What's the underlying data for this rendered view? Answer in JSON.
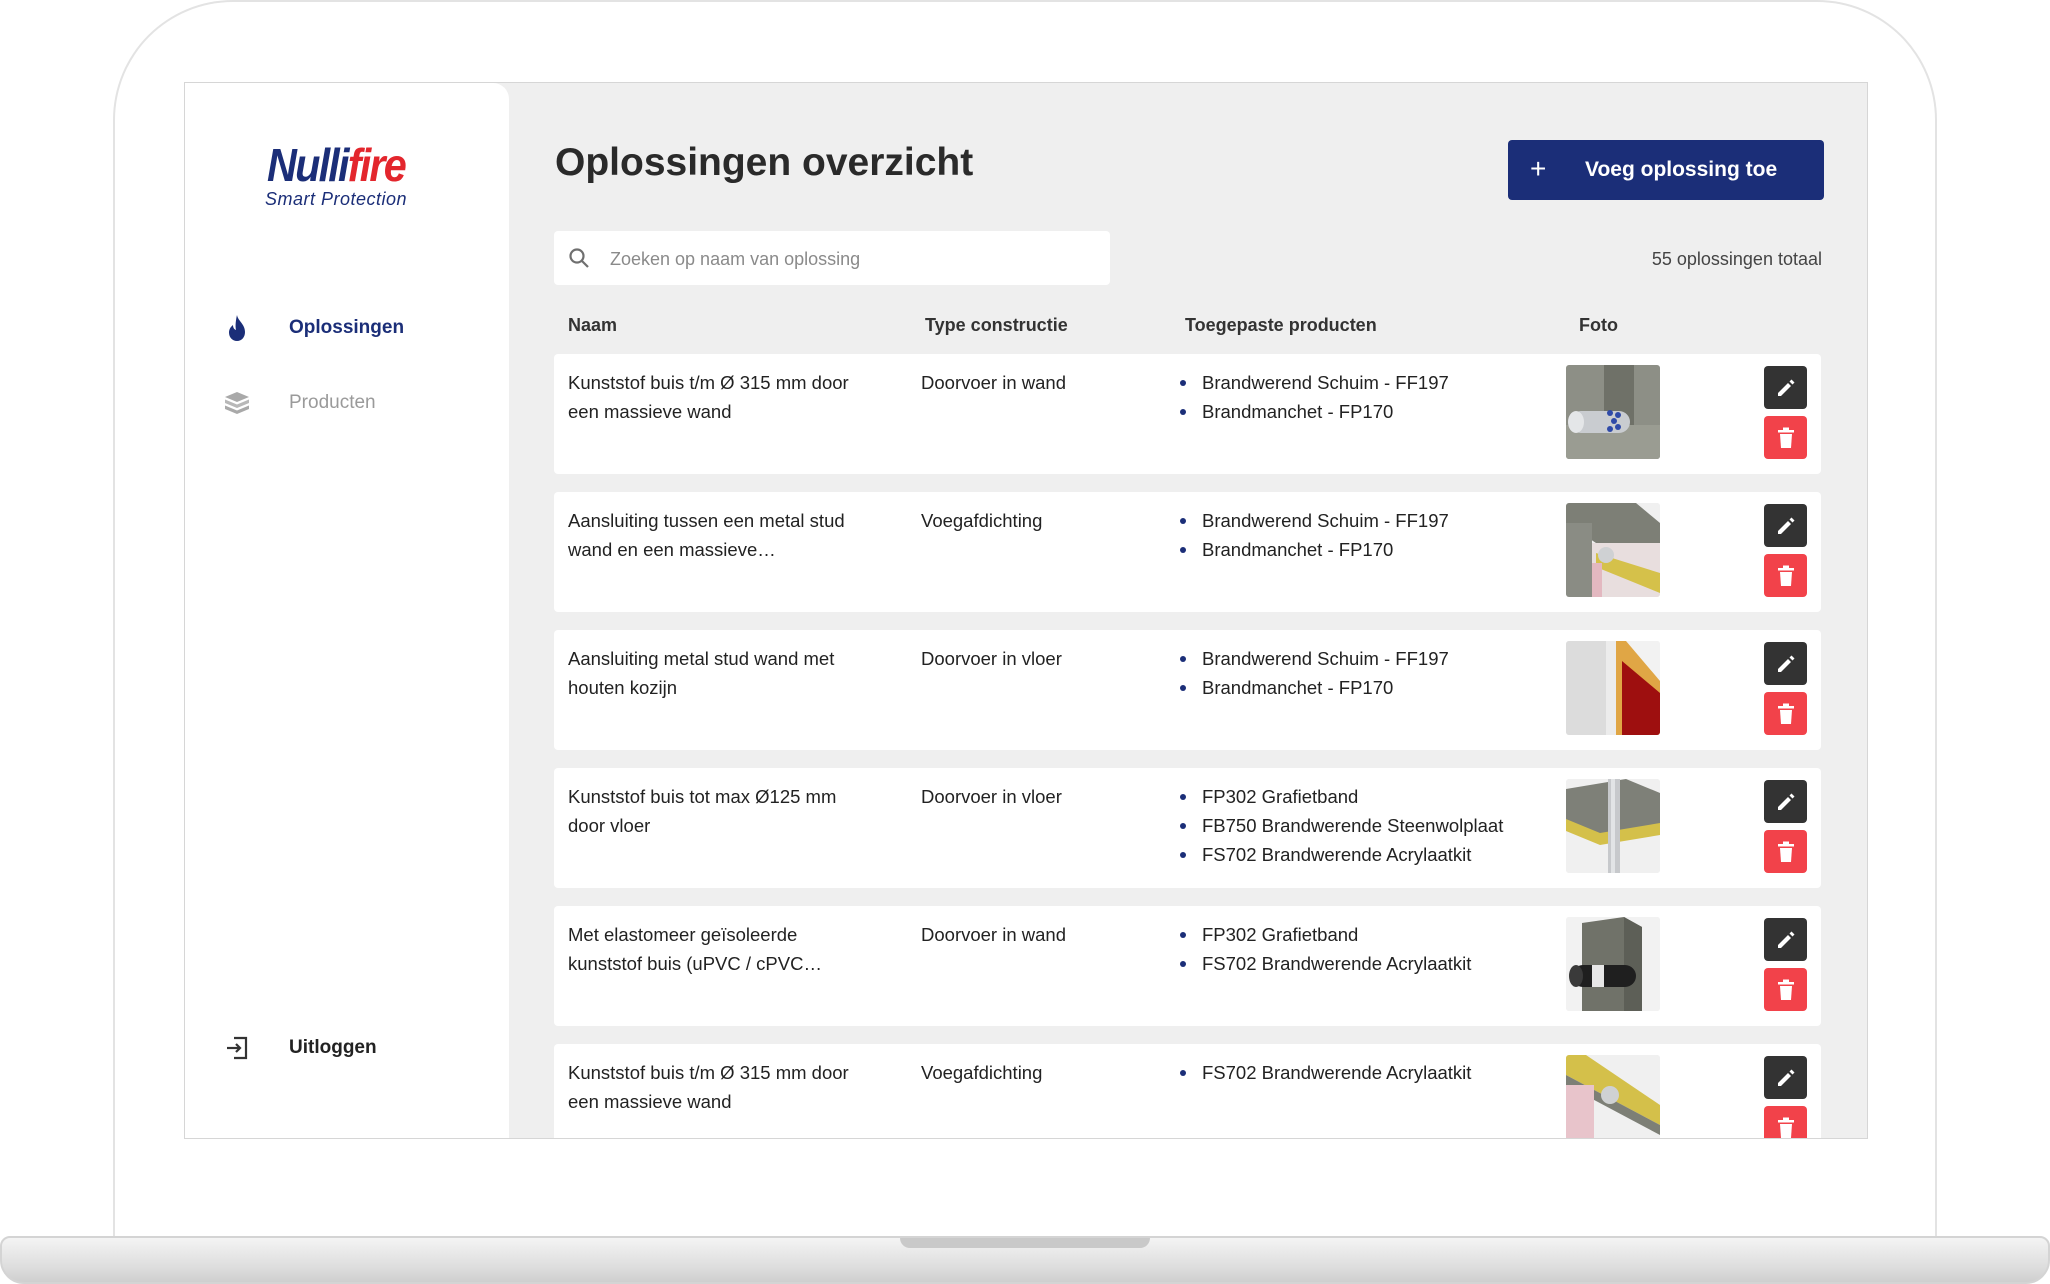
{
  "app": {
    "logo_main_dark": "Nulli",
    "logo_main_red": "fire",
    "logo_sub": "Smart Protection"
  },
  "sidebar": {
    "items": [
      {
        "label": "Oplossingen",
        "icon": "flame-icon",
        "active": true
      },
      {
        "label": "Producten",
        "icon": "box-icon",
        "active": false
      }
    ],
    "logout_label": "Uitloggen"
  },
  "header": {
    "title": "Oplossingen overzicht",
    "add_button_icon": "+",
    "add_button_label": "Voeg oplossing toe"
  },
  "search": {
    "placeholder": "Zoeken op naam van oplossing",
    "value": ""
  },
  "summary": {
    "total_text": "55 oplossingen totaal"
  },
  "table": {
    "columns": [
      "Naam",
      "Type constructie",
      "Toegepaste producten",
      "Foto"
    ],
    "rows": [
      {
        "name": "Kunststof buis t/m Ø 315 mm door een massieve wand",
        "type": "Doorvoer in wand",
        "products": [
          "Brandwerend Schuim - FF197",
          "Brandmanchet - FP170"
        ]
      },
      {
        "name": "Aansluiting tussen een metal stud wand en een massieve…",
        "type": "Voegafdichting",
        "products": [
          "Brandwerend Schuim - FF197",
          "Brandmanchet - FP170"
        ]
      },
      {
        "name": "Aansluiting metal stud wand met houten kozijn",
        "type": "Doorvoer in vloer",
        "products": [
          "Brandwerend Schuim - FF197",
          "Brandmanchet - FP170"
        ]
      },
      {
        "name": "Kunststof buis tot max Ø125 mm door vloer",
        "type": "Doorvoer in vloer",
        "products": [
          "FP302 Grafietband",
          "FB750 Brandwerende Steenwolplaat",
          "FS702 Brandwerende Acrylaatkit"
        ]
      },
      {
        "name": "Met elastomeer geïsoleerde kunststof buis (uPVC / cPVC…",
        "type": "Doorvoer in wand",
        "products": [
          "FP302 Grafietband",
          "FS702 Brandwerende Acrylaatkit"
        ]
      },
      {
        "name": "Kunststof buis t/m Ø 315 mm door een massieve wand",
        "type": "Voegafdichting",
        "products": [
          "FS702 Brandwerende Acrylaatkit"
        ]
      }
    ]
  },
  "colors": {
    "brand_blue": "#1b2e78",
    "brand_red": "#e3262d",
    "edit_button": "#333333",
    "delete_button": "#f2424a",
    "background": "#efefef"
  }
}
